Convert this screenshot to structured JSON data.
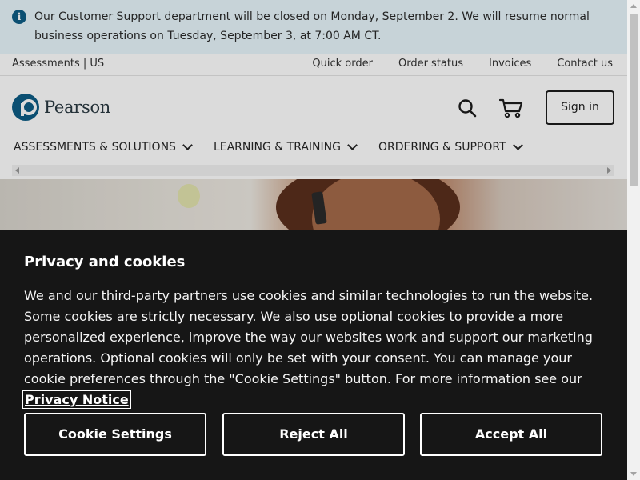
{
  "announcement": {
    "icon": "info-icon",
    "text": "Our Customer Support department will be closed on Monday, September 2. We will resume normal business operations on Tuesday, September 3, at 7:00 AM CT."
  },
  "utility": {
    "left": "Assessments | US",
    "links": [
      "Quick order",
      "Order status",
      "Invoices",
      "Contact us"
    ]
  },
  "header": {
    "logo_text": "Pearson",
    "sign_in": "Sign in",
    "icons": [
      "search-icon",
      "cart-icon"
    ]
  },
  "nav": {
    "items": [
      "ASSESSMENTS & SOLUTIONS",
      "LEARNING & TRAINING",
      "ORDERING & SUPPORT"
    ]
  },
  "cookie": {
    "title": "Privacy and cookies",
    "body": "We and our third-party partners use cookies and similar technologies to run the website. Some cookies are strictly necessary. We also use optional cookies to provide a more personalized experience, improve the way our websites work and support our marketing operations. Optional cookies will only be set with your consent. You can manage your cookie preferences through the \"Cookie Settings\" button. For more information see our",
    "link": "Privacy Notice",
    "buttons": {
      "settings": "Cookie Settings",
      "reject": "Reject All",
      "accept": "Accept All"
    }
  },
  "colors": {
    "brand": "#0d5c85",
    "announcement_bg": "#e8f6fc",
    "cookie_bg": "#161616"
  }
}
